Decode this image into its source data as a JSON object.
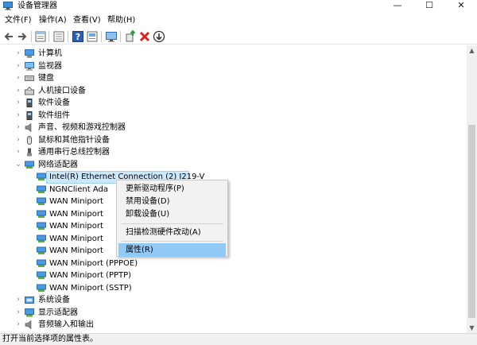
{
  "window": {
    "title": "设备管理器",
    "minimize_glyph": "—",
    "maximize_glyph": "☐",
    "close_glyph": "✕"
  },
  "menu": [
    "文件(F)",
    "操作(A)",
    "查看(V)",
    "帮助(H)"
  ],
  "toolbar": {
    "buttons": [
      "back-arrow-icon",
      "forward-arrow-icon",
      "properties-sheet-icon",
      "device-list-icon",
      "help-icon",
      "view-icon",
      "monitor-icon",
      "update-driver-icon",
      "uninstall-x-icon",
      "scan-download-icon"
    ],
    "colors": {
      "accent": "#1f6fd1",
      "delete": "#e0201b",
      "green": "#2e9a3a"
    }
  },
  "tree": {
    "items": [
      {
        "label": "计算机",
        "icon": "computer-icon",
        "expanded": false
      },
      {
        "label": "监视器",
        "icon": "monitor-icon",
        "expanded": false
      },
      {
        "label": "键盘",
        "icon": "keyboard-icon",
        "expanded": false
      },
      {
        "label": "人机接口设备",
        "icon": "hid-icon",
        "expanded": false
      },
      {
        "label": "软件设备",
        "icon": "software-device-icon",
        "expanded": false
      },
      {
        "label": "软件组件",
        "icon": "software-component-icon",
        "expanded": false
      },
      {
        "label": "声音、视频和游戏控制器",
        "icon": "speaker-icon",
        "expanded": false
      },
      {
        "label": "鼠标和其他指针设备",
        "icon": "mouse-icon",
        "expanded": false
      },
      {
        "label": "通用串行总线控制器",
        "icon": "usb-icon",
        "expanded": false
      },
      {
        "label": "网络适配器",
        "icon": "network-adapter-icon",
        "expanded": true
      },
      {
        "label": "系统设备",
        "icon": "system-device-icon",
        "expanded": false
      },
      {
        "label": "显示适配器",
        "icon": "display-adapter-icon",
        "expanded": false
      },
      {
        "label": "音频输入和输出",
        "icon": "audio-io-icon",
        "expanded": false
      }
    ],
    "network_children": [
      "Intel(R) Ethernet Connection (2) I219-V",
      "NGNClient Ada",
      "WAN Miniport",
      "WAN Miniport",
      "WAN Miniport",
      "WAN Miniport",
      "WAN Miniport",
      "WAN Miniport (PPPOE)",
      "WAN Miniport (PPTP)",
      "WAN Miniport (SSTP)"
    ]
  },
  "context_menu": {
    "items": [
      "更新驱动程序(P)",
      "禁用设备(D)",
      "卸载设备(U)",
      "扫描检测硬件改动(A)",
      "属性(R)"
    ],
    "highlighted": "属性(R)"
  },
  "status": {
    "text": "打开当前选择项的属性表。"
  }
}
